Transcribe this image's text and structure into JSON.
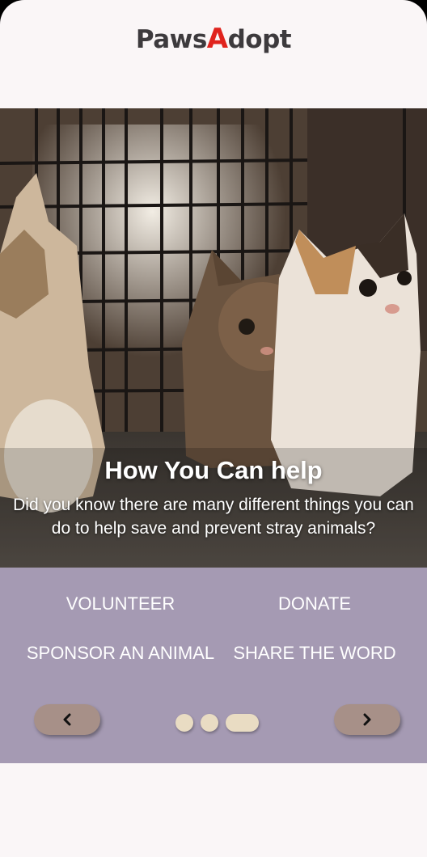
{
  "header": {
    "logo_part1": "Paws",
    "logo_accent": "A",
    "logo_part2": "dopt"
  },
  "hero": {
    "title": "How You Can help",
    "subtitle": "Did you know there are many different things you can do to help save and prevent stray animals?"
  },
  "options": {
    "volunteer": "VOLUNTEER",
    "donate": "DONATE",
    "sponsor": "SPONSOR AN ANIMAL",
    "share": "SHARE THE WORD"
  },
  "carousel": {
    "slide_count": 3,
    "active_index": 2
  },
  "colors": {
    "accent": "#e0231d",
    "panel": "#a59ab3",
    "nav_button": "#a79088",
    "dot": "#e9dcc3"
  }
}
